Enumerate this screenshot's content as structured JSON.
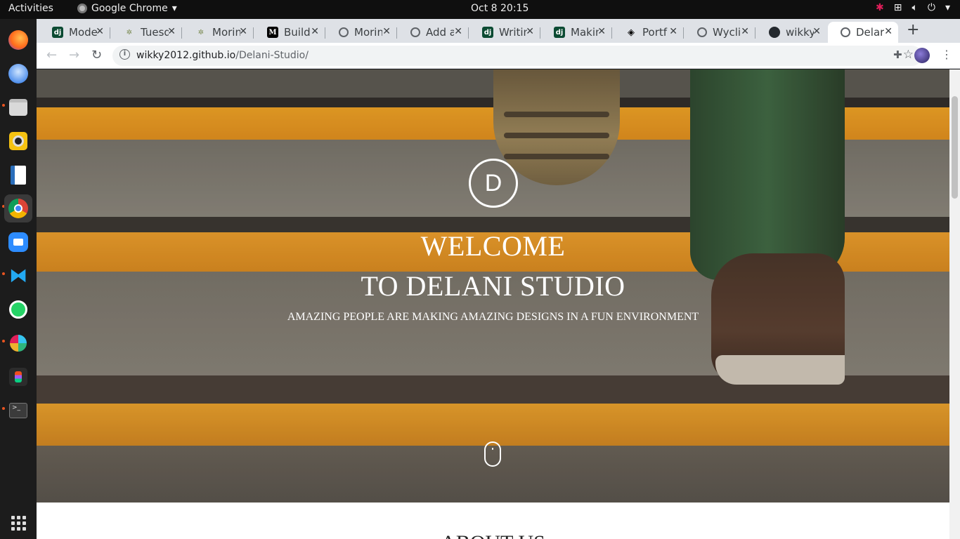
{
  "topbar": {
    "activities": "Activities",
    "app_name": "Google Chrome",
    "clock": "Oct 8  20:15",
    "tray_icons": [
      "slack-tray-icon",
      "network-icon",
      "volume-icon",
      "power-icon"
    ]
  },
  "dock": {
    "items": [
      "firefox-icon",
      "thunderbird-icon",
      "files-icon",
      "rhythmbox-icon",
      "writer-icon",
      "chrome-icon",
      "zoom-icon",
      "vscode-icon",
      "whatsapp-icon",
      "slack-icon",
      "figma-icon",
      "terminal-icon",
      "app-grid-icon"
    ]
  },
  "tabs": [
    {
      "label": "Mode",
      "icon": "django-icon"
    },
    {
      "label": "Tuesd",
      "icon": "palm-icon"
    },
    {
      "label": "Morin",
      "icon": "palm-icon"
    },
    {
      "label": "Build",
      "icon": "medium-icon"
    },
    {
      "label": "Morin",
      "icon": "globe-icon"
    },
    {
      "label": "Add a",
      "icon": "globe-icon"
    },
    {
      "label": "Writin",
      "icon": "django-icon"
    },
    {
      "label": "Makin",
      "icon": "django-icon"
    },
    {
      "label": "Portf",
      "icon": "codepen-icon"
    },
    {
      "label": "Wycli",
      "icon": "globe-icon"
    },
    {
      "label": "wikky",
      "icon": "github-icon"
    },
    {
      "label": "Delar",
      "icon": "globe-icon",
      "active": true
    }
  ],
  "toolbar": {
    "url_host": "wikky2012.github.io",
    "url_path": "/Delani-Studio/"
  },
  "hero": {
    "logo_letter": "D",
    "title_line1": "WELCOME",
    "title_line2": "TO DELANI STUDIO",
    "subtitle": "AMAZING PEOPLE ARE MAKING AMAZING DESIGNS IN A FUN ENVIRONMENT"
  },
  "about": {
    "heading": "ABOUT US"
  },
  "colors": {
    "stripe_orange": "#f0a52a",
    "stair_grey": "#6e6a62"
  }
}
